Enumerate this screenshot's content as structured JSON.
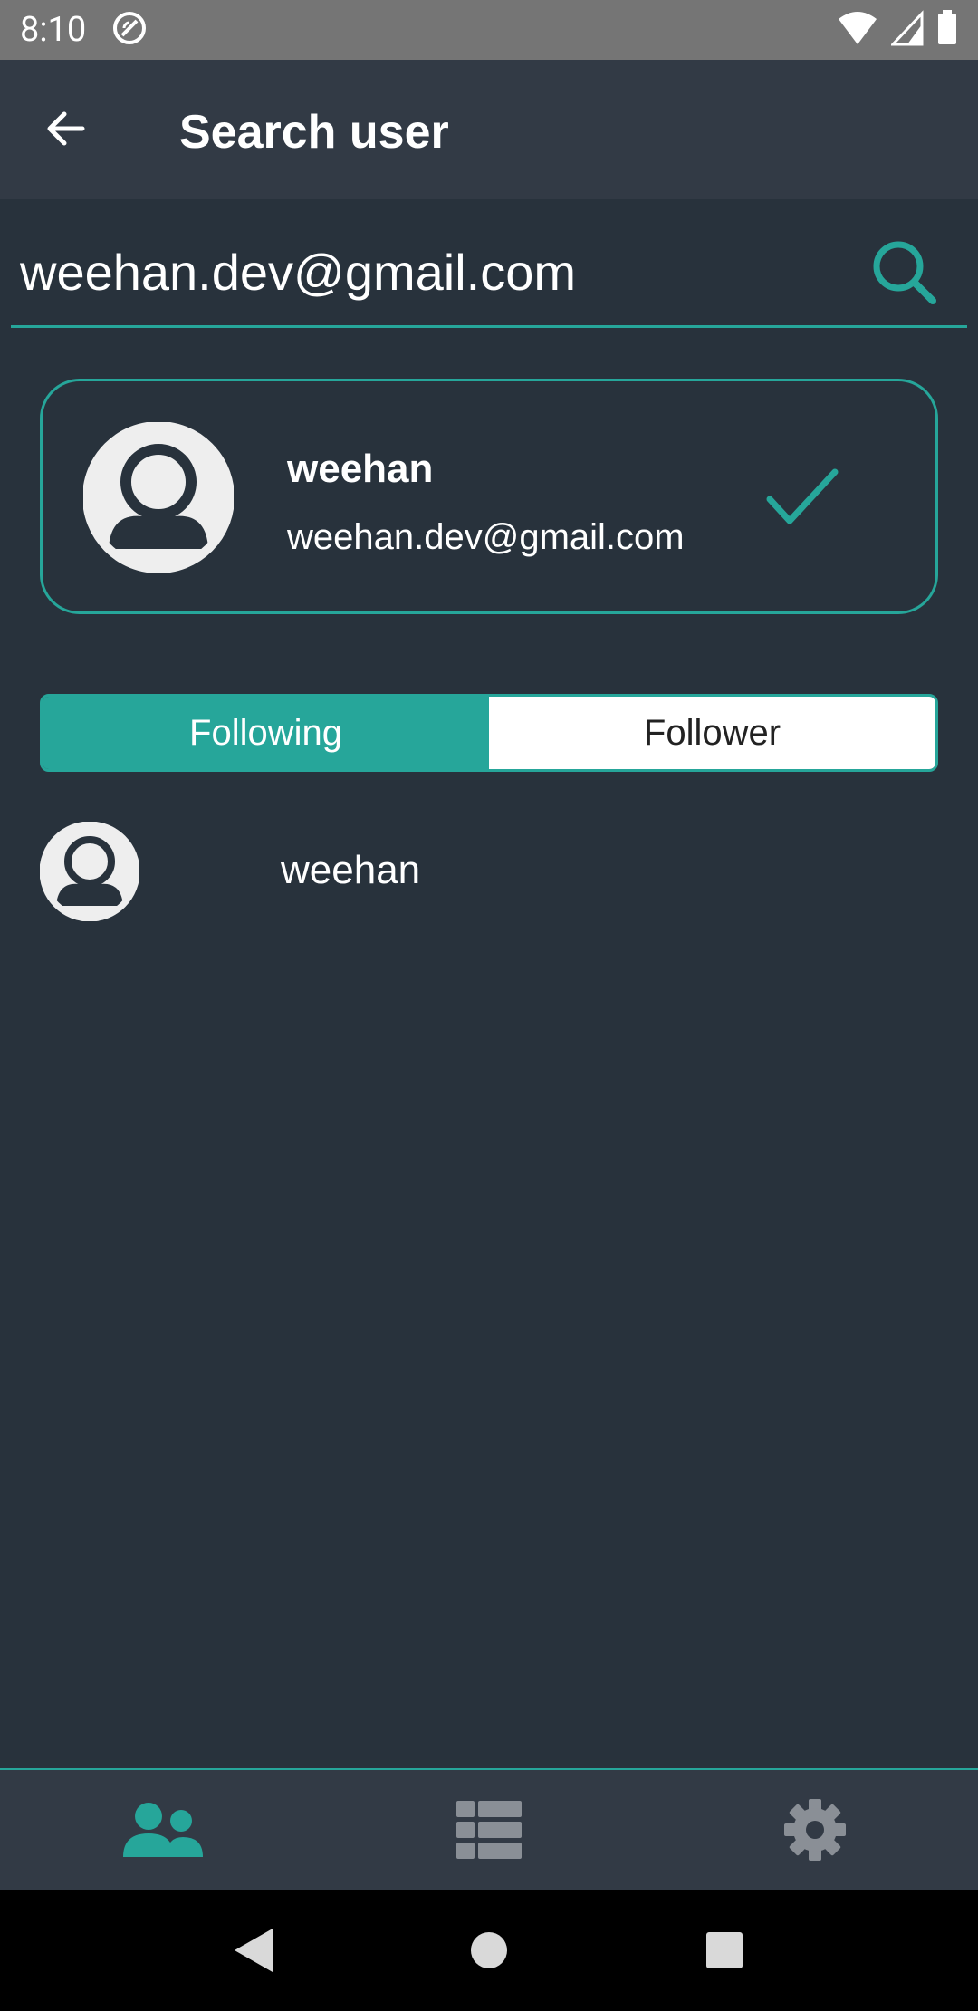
{
  "status_bar": {
    "time": "8:10"
  },
  "app_bar": {
    "title": "Search user"
  },
  "search": {
    "value": "weehan.dev@gmail.com",
    "accent_color": "#26a69a"
  },
  "user_card": {
    "name": "weehan",
    "email": "weehan.dev@gmail.com",
    "status_icon": "check-icon"
  },
  "tabs": [
    {
      "label": "Following",
      "active": true
    },
    {
      "label": "Follower",
      "active": false
    }
  ],
  "list": {
    "items": [
      {
        "name": "weehan"
      }
    ]
  },
  "bottom_nav": {
    "items": [
      {
        "icon": "users-icon",
        "active": true
      },
      {
        "icon": "list-icon",
        "active": false
      },
      {
        "icon": "gear-icon",
        "active": false
      }
    ]
  },
  "colors": {
    "background": "#28323c",
    "app_bar": "#323a45",
    "accent": "#26a69a",
    "inactive_icon": "#8a8f96"
  }
}
